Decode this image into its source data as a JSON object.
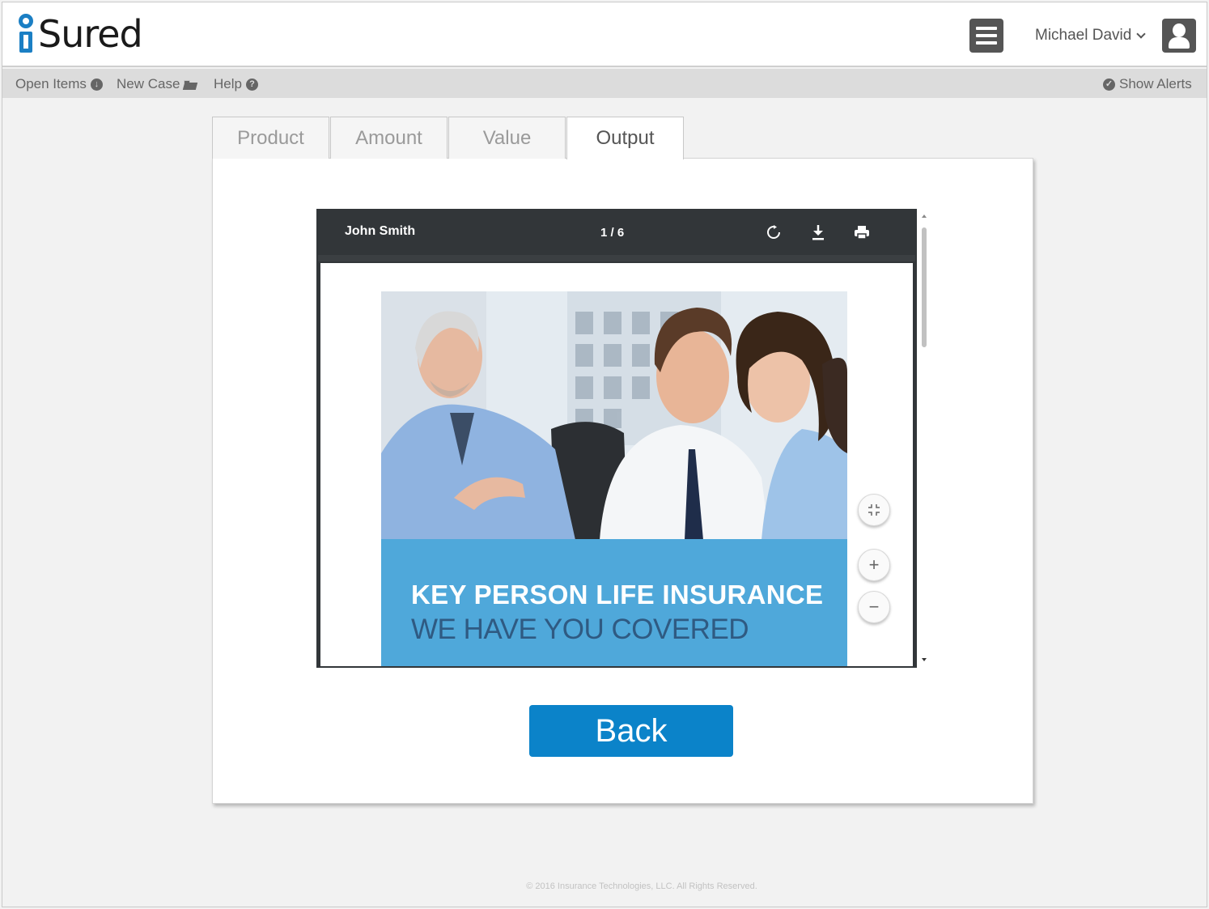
{
  "app": {
    "logo_text": "Sured",
    "brand_color": "#1b7fc4"
  },
  "header": {
    "user_name": "Michael David"
  },
  "subnav": {
    "open_items": "Open Items",
    "new_case": "New Case",
    "help": "Help",
    "show_alerts": "Show Alerts"
  },
  "tabs": [
    {
      "label": "Product"
    },
    {
      "label": "Amount"
    },
    {
      "label": "Value"
    },
    {
      "label": "Output",
      "active": true
    }
  ],
  "viewer": {
    "document_name": "John Smith",
    "page_indicator": "1 / 6",
    "cover_title": "KEY PERSON LIFE INSURANCE",
    "cover_subtitle": "WE HAVE YOU COVERED"
  },
  "actions": {
    "back_label": "Back"
  },
  "footer": {
    "copyright": "© 2016 Insurance Technologies, LLC. All Rights Reserved."
  },
  "colors": {
    "primary_button": "#0b83c9",
    "banner": "#4fa8da",
    "viewer_toolbar": "#323639"
  }
}
